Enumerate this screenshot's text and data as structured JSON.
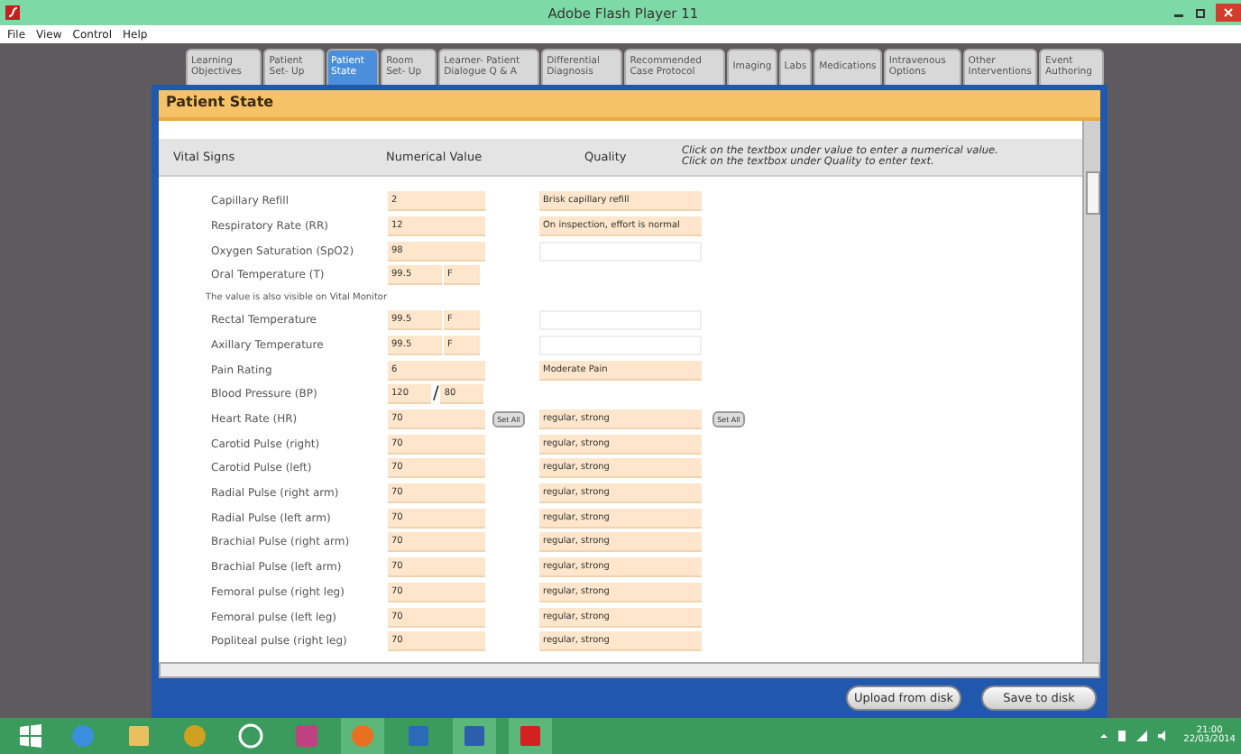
{
  "window": {
    "title": "Adobe Flash Player 11"
  },
  "menu": [
    "File",
    "View",
    "Control",
    "Help"
  ],
  "tabs": [
    {
      "label": "Learning Objectives",
      "selected": false
    },
    {
      "label": "Patient Set- Up",
      "selected": false
    },
    {
      "label": "Patient State",
      "selected": true
    },
    {
      "label": "Room Set- Up",
      "selected": false
    },
    {
      "label": "Learner- Patient Dialogue Q & A",
      "selected": false
    },
    {
      "label": "Differential Diagnosis",
      "selected": false
    },
    {
      "label": "Recommended Case Protocol",
      "selected": false
    },
    {
      "label": "Imaging",
      "selected": false
    },
    {
      "label": "Labs",
      "selected": false
    },
    {
      "label": "Medications",
      "selected": false
    },
    {
      "label": "Intravenous Options",
      "selected": false
    },
    {
      "label": "Other Interventions",
      "selected": false
    },
    {
      "label": "Event Authoring",
      "selected": false
    }
  ],
  "panel": {
    "title": "Patient State",
    "columns": [
      "Vital Signs",
      "Numerical Value",
      "Quality"
    ],
    "instructions": [
      "Click on the textbox under value to enter a numerical value.",
      "Click on the textbox under Quality to enter text."
    ],
    "rows": [
      {
        "kind": "vital",
        "name": "Capillary Refill",
        "value": "2",
        "quality": {
          "kind": "filled",
          "text": "Brisk capillary refill"
        }
      },
      {
        "kind": "vital",
        "name": "Respiratory Rate (RR)",
        "value": "12",
        "quality": {
          "kind": "filled",
          "text": "On inspection, effort is normal"
        }
      },
      {
        "kind": "vital",
        "name": "Oxygen Saturation (SpO2)",
        "value": "98",
        "quality": {
          "kind": "blank"
        }
      },
      {
        "kind": "vital",
        "name": "Oral Temperature (T)",
        "value": "99.5",
        "unit": "F"
      },
      {
        "kind": "note",
        "name": "The value is also visible on Vital Monitor"
      },
      {
        "kind": "vital",
        "name": "Rectal Temperature",
        "value": "99.5",
        "unit": "F",
        "quality": {
          "kind": "blank"
        }
      },
      {
        "kind": "vital",
        "name": "Axillary Temperature",
        "value": "99.5",
        "unit": "F",
        "quality": {
          "kind": "blank"
        }
      },
      {
        "kind": "vital",
        "name": "Pain Rating",
        "value": "6",
        "quality": {
          "kind": "filled",
          "text": "Moderate Pain"
        }
      },
      {
        "kind": "bp",
        "name": "Blood Pressure (BP)",
        "value": "120",
        "value2": "80",
        "separator": "/"
      },
      {
        "kind": "vital",
        "name": "Heart Rate (HR)",
        "value": "70",
        "value_button": "Set All",
        "quality": {
          "kind": "filled",
          "text": "regular, strong"
        },
        "quality_button": "Set All"
      },
      {
        "kind": "vital",
        "name": "Carotid Pulse (right)",
        "value": "70",
        "quality": {
          "kind": "filled",
          "text": "regular, strong"
        }
      },
      {
        "kind": "vital",
        "name": "Carotid Pulse (left)",
        "value": "70",
        "quality": {
          "kind": "filled",
          "text": "regular, strong"
        }
      },
      {
        "kind": "vital",
        "name": "Radial Pulse (right arm)",
        "value": "70",
        "quality": {
          "kind": "filled",
          "text": "regular, strong"
        }
      },
      {
        "kind": "vital",
        "name": "Radial Pulse (left arm)",
        "value": "70",
        "quality": {
          "kind": "filled",
          "text": "regular, strong"
        }
      },
      {
        "kind": "vital",
        "name": "Brachial Pulse (right arm)",
        "value": "70",
        "quality": {
          "kind": "filled",
          "text": "regular, strong"
        }
      },
      {
        "kind": "vital",
        "name": "Brachial Pulse (left arm)",
        "value": "70",
        "quality": {
          "kind": "filled",
          "text": "regular, strong"
        }
      },
      {
        "kind": "vital",
        "name": "Femoral pulse (right leg)",
        "value": "70",
        "quality": {
          "kind": "filled",
          "text": "regular, strong"
        }
      },
      {
        "kind": "vital",
        "name": "Femoral pulse (left leg)",
        "value": "70",
        "quality": {
          "kind": "filled",
          "text": "regular, strong"
        }
      },
      {
        "kind": "vital",
        "name": "Popliteal pulse (right leg)",
        "value": "70",
        "quality": {
          "kind": "filled",
          "text": "regular, strong"
        }
      }
    ]
  },
  "buttons": [
    "Upload from disk",
    "Save to disk"
  ],
  "taskbar": {
    "apps": [
      {
        "kind": "ie",
        "active": false
      },
      {
        "kind": "folder",
        "active": false
      },
      {
        "kind": "round",
        "active": false
      },
      {
        "kind": "hp",
        "active": false
      },
      {
        "kind": "colors",
        "active": false
      },
      {
        "kind": "firefox",
        "active": true
      },
      {
        "kind": "outlook",
        "active": false
      },
      {
        "kind": "word",
        "active": true
      },
      {
        "kind": "flash",
        "active": true
      }
    ],
    "time": "21:00",
    "date": "22/03/2014"
  }
}
